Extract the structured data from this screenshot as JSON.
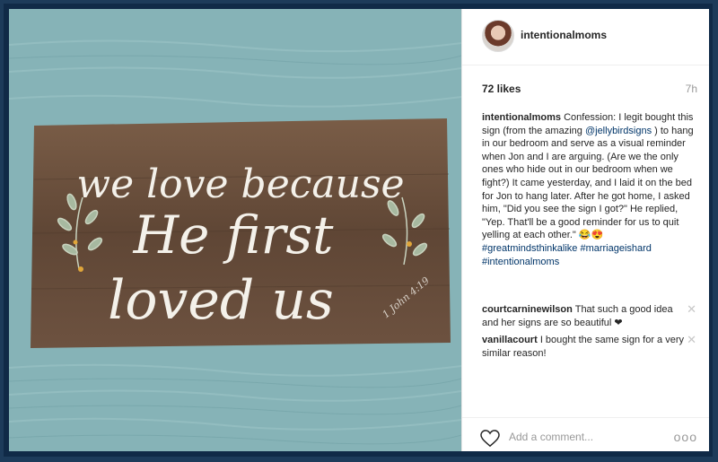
{
  "post": {
    "username": "intentionalmoms",
    "likes": "72 likes",
    "time": "7h",
    "caption": {
      "username": "intentionalmoms",
      "text_1": "Confession: I legit bought this sign (from the amazing",
      "mention": "@jellybirdsigns",
      "text_2": ") to hang in our bedroom and serve as a visual reminder when Jon and I are arguing. (Are we the only ones who hide out in our bedroom when we fight?) It came yesterday, and I laid it on the bed for Jon to hang later. After he got home, I asked him, \"Did you see the sign I got?\" He replied, \"Yep. That'll be a good reminder for us to quit yelling at each other.\" 😂😍",
      "hashtags": "#greatmindsthinkalike #marriageishard #intentionalmoms"
    },
    "comments": [
      {
        "username": "courtcarninewilson",
        "text": "That such a good idea and her signs are so beautiful ❤"
      },
      {
        "username": "vanillacourt",
        "text": "I bought the same sign for a very similar reason!"
      }
    ],
    "add_comment_placeholder": "Add a comment...",
    "more_label": "ooo",
    "remove_glyph": "✕"
  },
  "sign": {
    "line1": "we love because",
    "line2": "He first",
    "line3": "loved us",
    "reference": "1 John 4:19"
  },
  "colors": {
    "frame": "#102a47",
    "photo_bg": "#86b3b7",
    "wood": "#6e5440",
    "link": "#003569"
  }
}
